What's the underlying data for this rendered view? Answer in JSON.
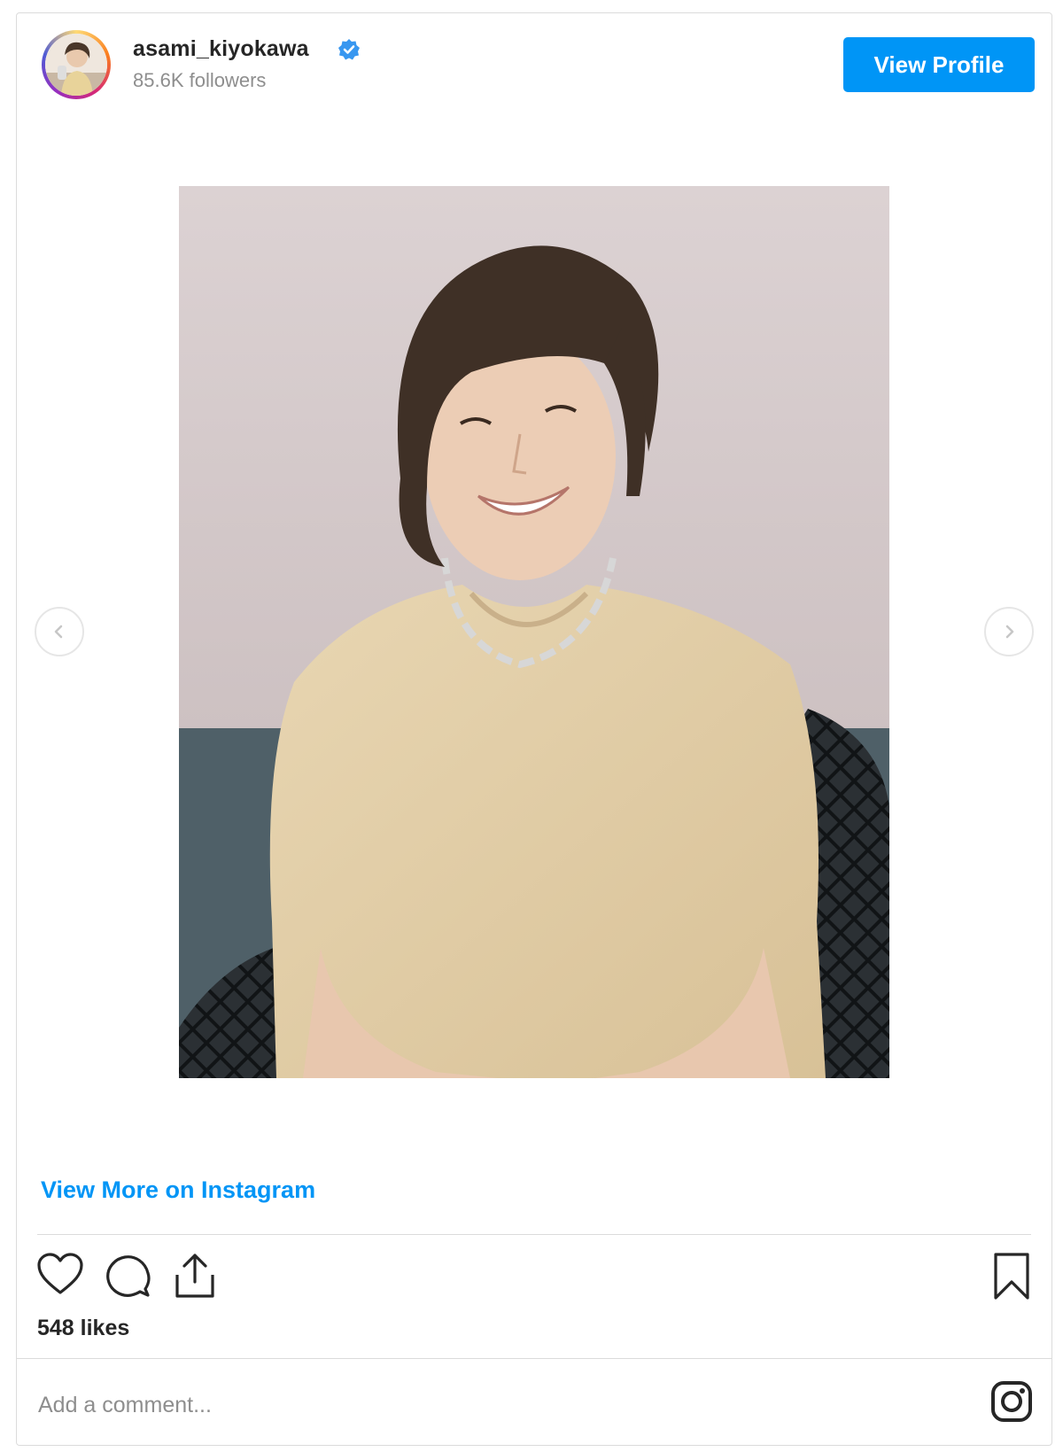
{
  "header": {
    "username": "asami_kiyokawa",
    "followers": "85.6K followers",
    "verified_icon": "verified-badge-icon",
    "view_profile_label": "View Profile"
  },
  "post": {
    "image_alt": "",
    "carousel_prev_icon": "chevron-left-icon",
    "carousel_next_icon": "chevron-right-icon"
  },
  "view_more_label": "View More on Instagram",
  "actions": {
    "like_icon": "heart-icon",
    "comment_icon": "comment-icon",
    "share_icon": "share-icon",
    "save_icon": "bookmark-icon"
  },
  "likes": "548 likes",
  "comment": {
    "placeholder": "Add a comment...",
    "value": ""
  },
  "brand_icon": "instagram-icon",
  "colors": {
    "accent": "#0095f6",
    "text": "#262626",
    "muted": "#8e8e8e",
    "border": "#dbdbdb"
  }
}
